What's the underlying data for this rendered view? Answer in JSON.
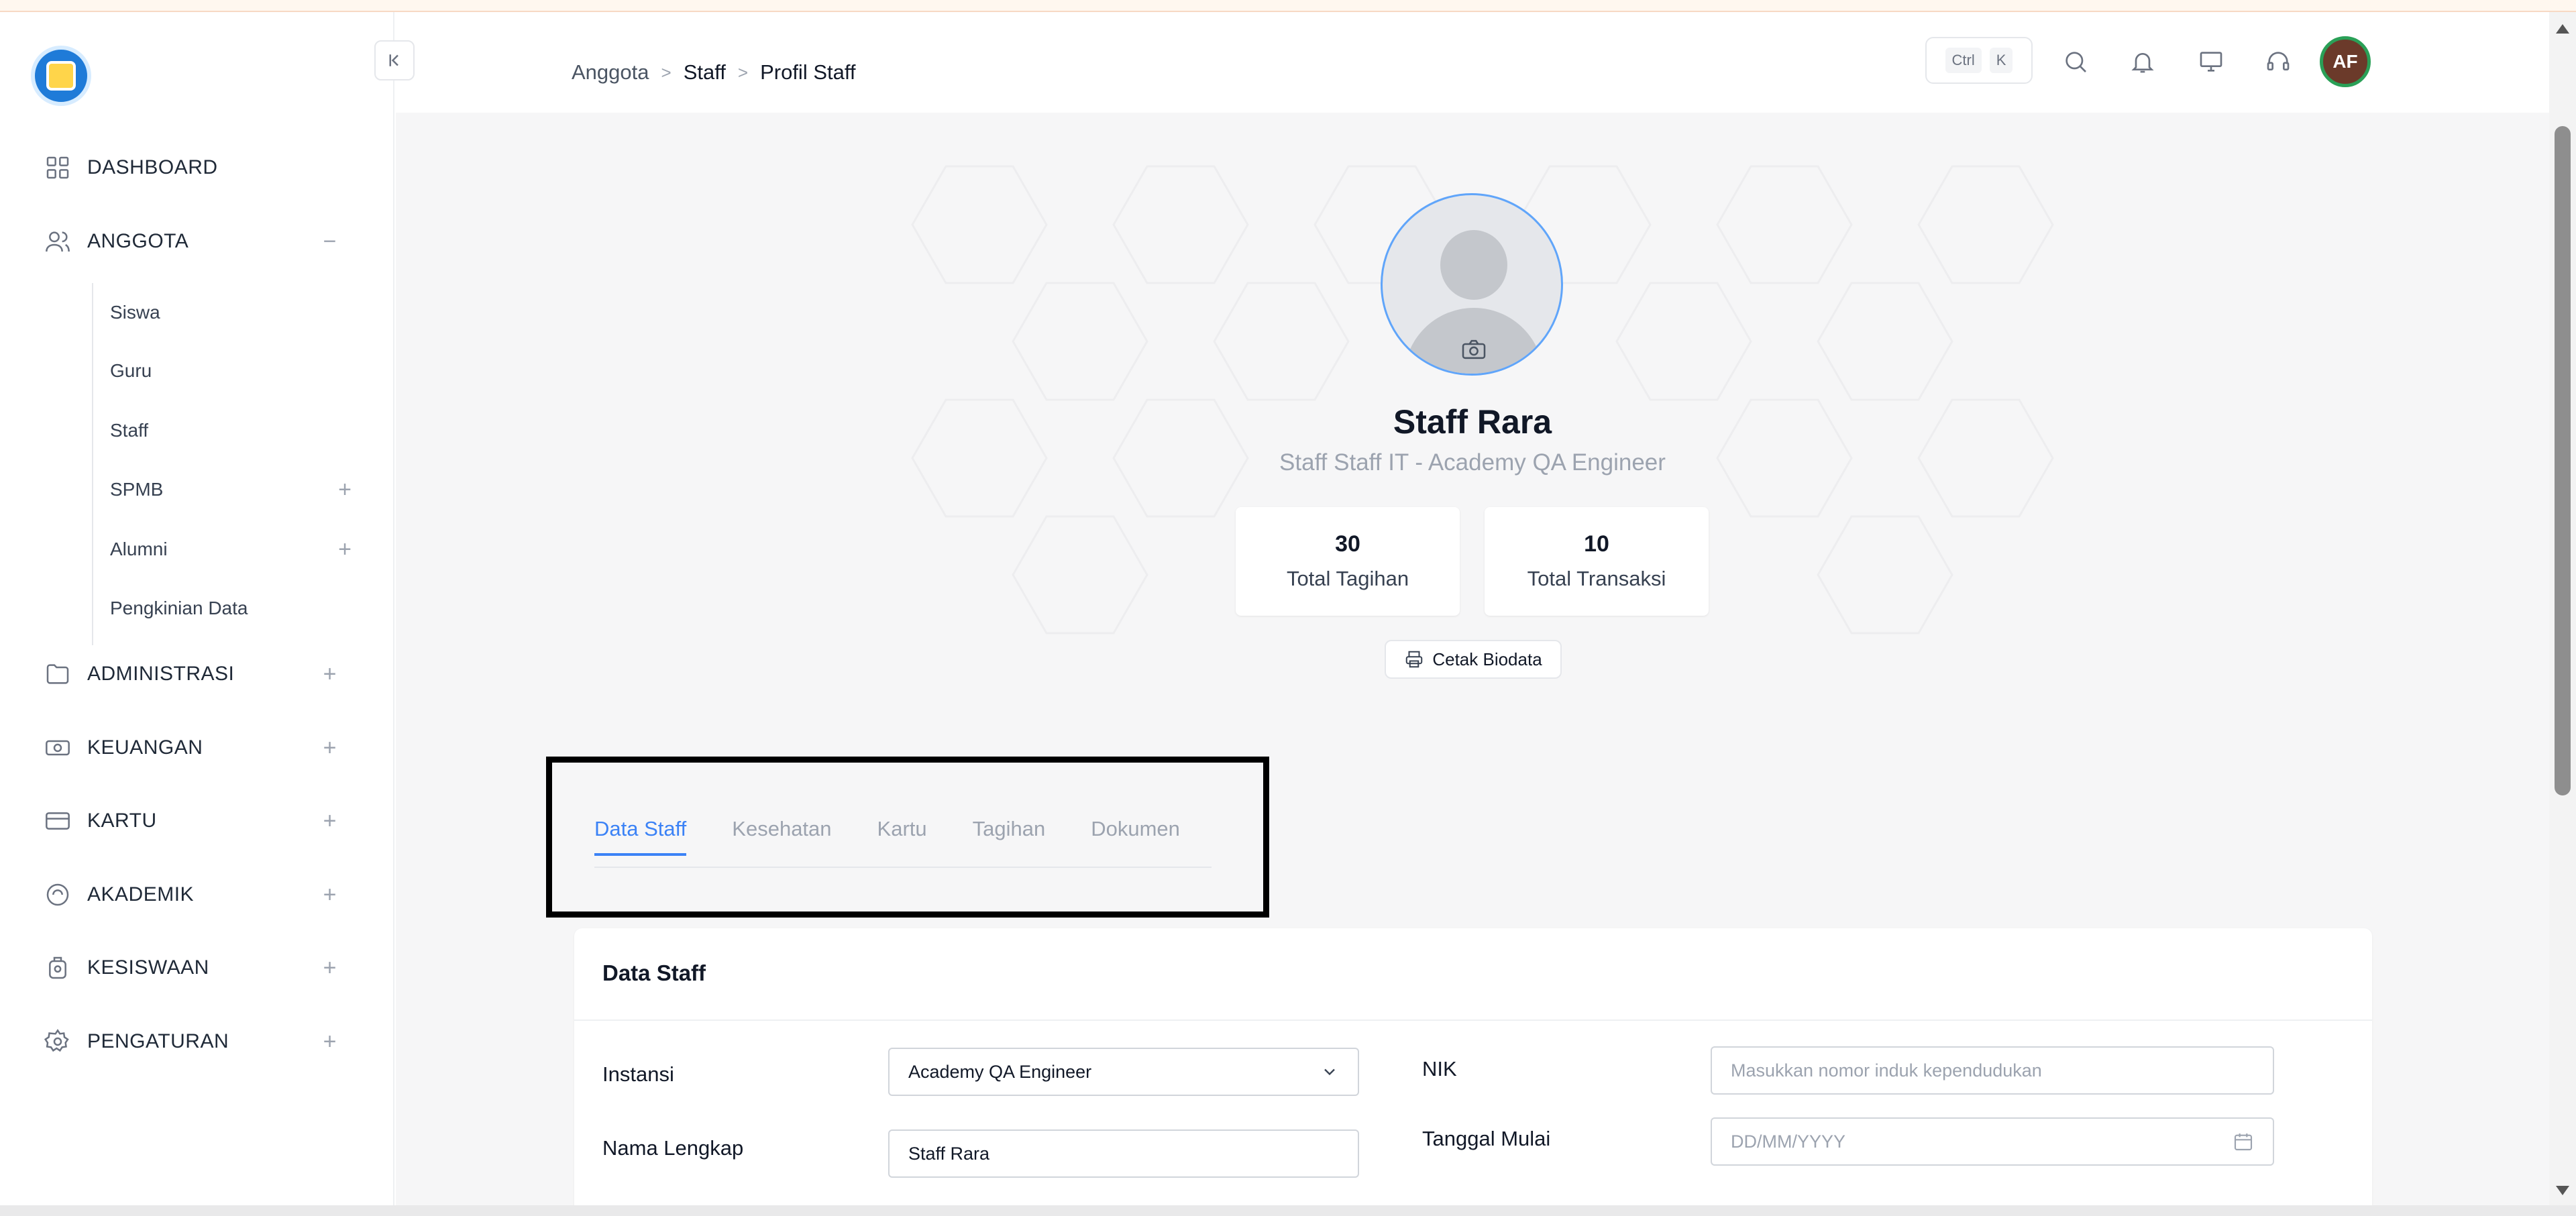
{
  "sidebar": {
    "items": [
      {
        "label": "DASHBOARD",
        "icon": "dashboard-grid-icon",
        "toggle": ""
      },
      {
        "label": "ANGGOTA",
        "icon": "users-icon",
        "toggle": "−"
      },
      {
        "label": "ADMINISTRASI",
        "icon": "folder-icon",
        "toggle": "+"
      },
      {
        "label": "KEUANGAN",
        "icon": "money-icon",
        "toggle": "+"
      },
      {
        "label": "KARTU",
        "icon": "card-icon",
        "toggle": "+"
      },
      {
        "label": "AKADEMIK",
        "icon": "academic-icon",
        "toggle": "+"
      },
      {
        "label": "KESISWAAN",
        "icon": "student-icon",
        "toggle": "+"
      },
      {
        "label": "PENGATURAN",
        "icon": "settings-icon",
        "toggle": "+"
      }
    ],
    "anggota_sub": [
      {
        "label": "Siswa",
        "toggle": ""
      },
      {
        "label": "Guru",
        "toggle": ""
      },
      {
        "label": "Staff",
        "toggle": ""
      },
      {
        "label": "SPMB",
        "toggle": "+"
      },
      {
        "label": "Alumni",
        "toggle": "+"
      },
      {
        "label": "Pengkinian Data",
        "toggle": ""
      }
    ]
  },
  "header": {
    "breadcrumb": [
      "Anggota",
      "Staff",
      "Profil Staff"
    ],
    "separator": ">",
    "shortcut": [
      "Ctrl",
      "K"
    ],
    "avatar_initials": "AF"
  },
  "profile": {
    "name": "Staff Rara",
    "subtitle": "Staff Staff IT - Academy QA Engineer",
    "stats": [
      {
        "value": "30",
        "label": "Total Tagihan"
      },
      {
        "value": "10",
        "label": "Total Transaksi"
      }
    ],
    "print_label": "Cetak Biodata"
  },
  "tabs": [
    "Data Staff",
    "Kesehatan",
    "Kartu",
    "Tagihan",
    "Dokumen"
  ],
  "active_tab": "Data Staff",
  "form": {
    "title": "Data Staff",
    "instansi_label": "Instansi",
    "instansi_value": "Academy QA Engineer",
    "nama_label": "Nama Lengkap",
    "nama_value": "Staff Rara",
    "nik_label": "NIK",
    "nik_placeholder": "Masukkan nomor induk kependudukan",
    "tanggal_label": "Tanggal Mulai",
    "tanggal_placeholder": "DD/MM/YYYY"
  },
  "colors": {
    "accent": "#3b82f6",
    "avatar_bg": "#6b3a2a",
    "avatar_ring": "#2aa057",
    "highlight_frame": "#000000"
  }
}
